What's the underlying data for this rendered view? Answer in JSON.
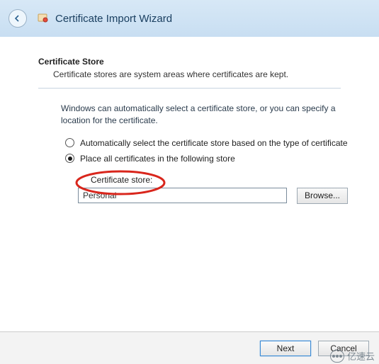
{
  "titlebar": {
    "title": "Certificate Import Wizard"
  },
  "section": {
    "heading": "Certificate Store",
    "description": "Certificate stores are system areas where certificates are kept."
  },
  "instruction": "Windows can automatically select a certificate store, or you can specify a location for the certificate.",
  "radios": {
    "auto": "Automatically select the certificate store based on the type of certificate",
    "manual": "Place all certificates in the following store"
  },
  "store": {
    "label": "Certificate store:",
    "value": "Personal",
    "browse": "Browse..."
  },
  "footer": {
    "next": "Next",
    "cancel": "Cancel"
  },
  "watermark": "亿速云"
}
